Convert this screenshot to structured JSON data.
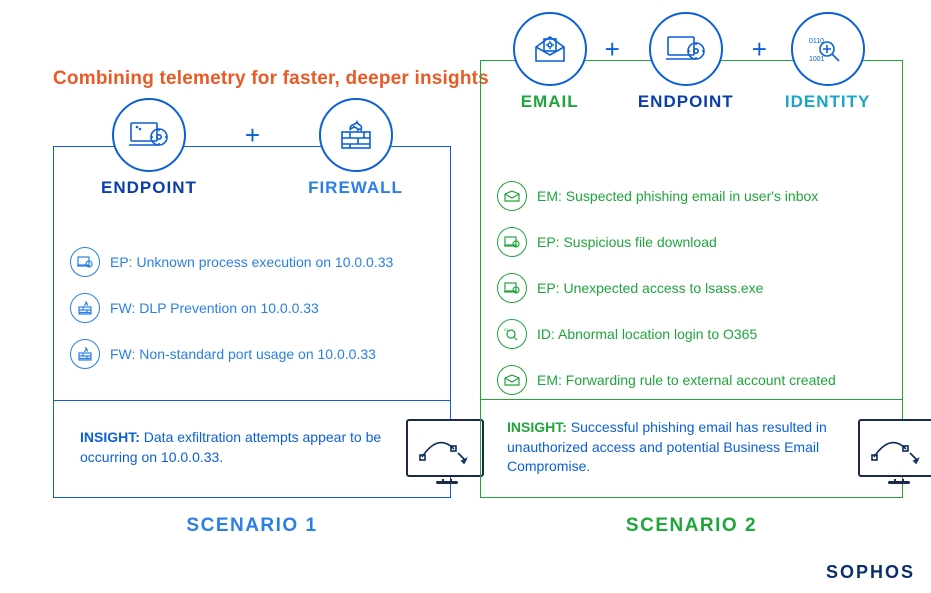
{
  "title": "Combining telemetry for faster, deeper insights",
  "brand": "SOPHOS",
  "plus": "+",
  "scenario1": {
    "label": "SCENARIO 1",
    "sources": {
      "endpoint": "ENDPOINT",
      "firewall": "FIREWALL"
    },
    "events": [
      {
        "icon": "endpoint",
        "text": "EP: Unknown process execution on 10.0.0.33"
      },
      {
        "icon": "firewall",
        "text": "FW: DLP Prevention on 10.0.0.33"
      },
      {
        "icon": "firewall",
        "text": "FW: Non-standard port usage on 10.0.0.33"
      }
    ],
    "insight_tag": "INSIGHT:",
    "insight_body": "Data exfiltration attempts appear to be occurring on 10.0.0.33."
  },
  "scenario2": {
    "label": "SCENARIO 2",
    "sources": {
      "email": "EMAIL",
      "endpoint": "ENDPOINT",
      "identity": "IDENTITY"
    },
    "events": [
      {
        "icon": "email",
        "text": "EM: Suspected phishing email in user's inbox"
      },
      {
        "icon": "endpoint",
        "text": "EP: Suspicious file download"
      },
      {
        "icon": "endpoint",
        "text": "EP: Unexpected access to lsass.exe"
      },
      {
        "icon": "identity",
        "text": "ID: Abnormal location login to O365"
      },
      {
        "icon": "email",
        "text": "EM: Forwarding rule to external account created"
      }
    ],
    "insight_tag": "INSIGHT:",
    "insight_body": "Successful phishing email has resulted in unauthorized access and potential Business Email Compromise."
  }
}
